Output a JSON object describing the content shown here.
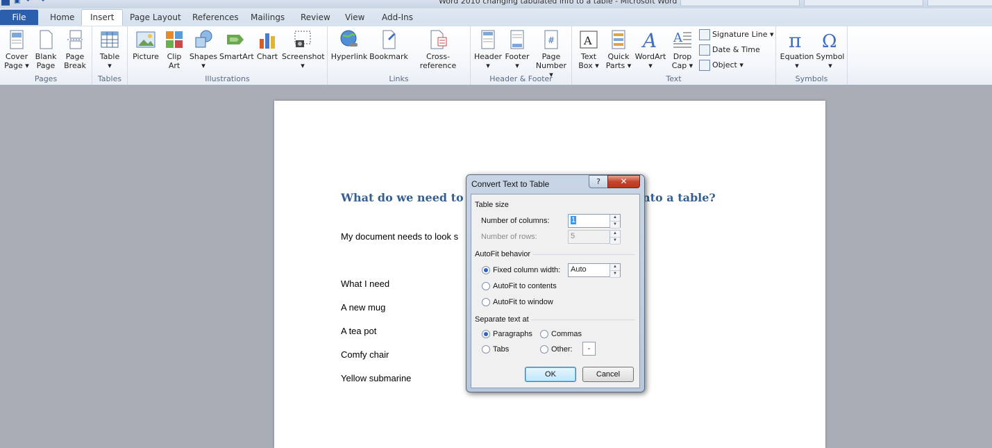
{
  "window": {
    "title": "Word 2010 changing tabulated info to a table - Microsoft Word"
  },
  "tabs": [
    "File",
    "Home",
    "Insert",
    "Page Layout",
    "References",
    "Mailings",
    "Review",
    "View",
    "Add-Ins"
  ],
  "ribbon": {
    "pages": {
      "label": "Pages",
      "cover": "Cover\nPage",
      "blank": "Blank\nPage",
      "break": "Page\nBreak"
    },
    "tables": {
      "label": "Tables",
      "table": "Table"
    },
    "illustrations": {
      "label": "Illustrations",
      "picture": "Picture",
      "clipart": "Clip\nArt",
      "shapes": "Shapes",
      "smartart": "SmartArt",
      "chart": "Chart",
      "screenshot": "Screenshot"
    },
    "links": {
      "label": "Links",
      "hyperlink": "Hyperlink",
      "bookmark": "Bookmark",
      "crossref": "Cross-reference"
    },
    "headerfooter": {
      "label": "Header & Footer",
      "header": "Header",
      "footer": "Footer",
      "pagenumber": "Page\nNumber"
    },
    "text": {
      "label": "Text",
      "textbox": "Text\nBox",
      "quickparts": "Quick\nParts",
      "wordart": "WordArt",
      "dropcap": "Drop\nCap",
      "signature": "Signature Line",
      "datetime": "Date & Time",
      "object": "Object"
    },
    "symbols": {
      "label": "Symbols",
      "equation": "Equation",
      "symbol": "Symbol"
    }
  },
  "document": {
    "heading_left": "What do we need to c",
    "heading_right": "nto a table?",
    "intro": "My document needs to look s",
    "lines": [
      "What I need",
      "A new mug",
      "A tea pot",
      "Comfy chair",
      "Yellow submarine"
    ]
  },
  "dialog": {
    "title": "Convert Text to Table",
    "help": "?",
    "table_size": "Table size",
    "num_columns_label": "Number of columns:",
    "num_columns_value": "1",
    "num_rows_label": "Number of rows:",
    "num_rows_value": "5",
    "autofit": "AutoFit behavior",
    "fixed_width": "Fixed column width:",
    "fixed_width_value": "Auto",
    "autofit_contents": "AutoFit to contents",
    "autofit_window": "AutoFit to window",
    "separate": "Separate text at",
    "paragraphs": "Paragraphs",
    "commas": "Commas",
    "tabs": "Tabs",
    "other": "Other:",
    "other_value": "-",
    "ok": "OK",
    "cancel": "Cancel"
  }
}
